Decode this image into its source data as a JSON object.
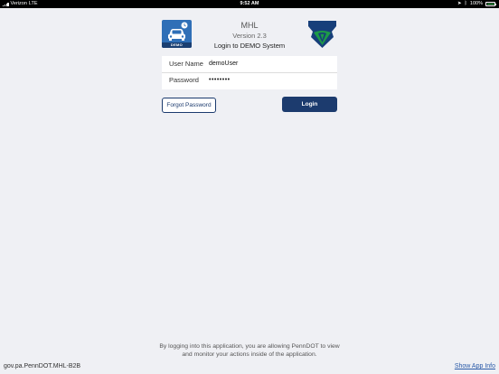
{
  "status_bar": {
    "carrier": "Verizon",
    "network": "LTE",
    "time": "9:52 AM",
    "battery_percent": "100%",
    "battery_level": 1.0
  },
  "app_icon": {
    "label": "DEMO"
  },
  "header": {
    "app_name": "MHL",
    "version": "Version 2.3",
    "login_to": "Login to DEMO System"
  },
  "form": {
    "username_label": "User Name",
    "username_value": "demoUser",
    "password_label": "Password",
    "password_value": "••••••••"
  },
  "buttons": {
    "forgot_password": "Forgot Password",
    "login": "Login"
  },
  "footer": {
    "disclaimer_line1": "By logging into this application, you are allowing PennDOT to view",
    "disclaimer_line2": "and monitor your actions inside of the application.",
    "bundle_id": "gov.pa.PennDOT.MHL-B2B",
    "show_app_info": "Show App Info"
  },
  "colors": {
    "primary": "#1c3b6e",
    "background": "#eff0f4",
    "keystone_blue": "#173f7a",
    "keystone_green": "#1d9b47"
  }
}
